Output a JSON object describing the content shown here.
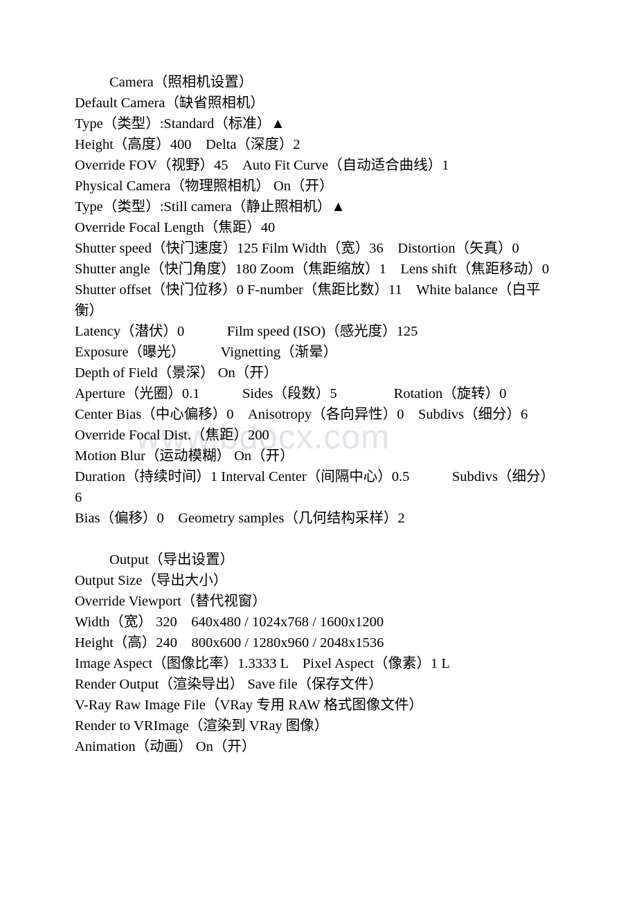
{
  "document": {
    "watermark": "www.bdocx.com",
    "sections": [
      {
        "id": "camera",
        "heading": "Camera（照相机设置）",
        "lines": [
          "Default Camera（缺省照相机）",
          "Type（类型）:Standard（标准）▲",
          "Height（高度）400　Delta（深度）2",
          "Override FOV（视野）45　Auto Fit Curve（自动适合曲线）1",
          "Physical Camera（物理照相机） On（开）",
          "Type（类型）:Still camera（静止照相机）▲",
          "Override Focal Length（焦距）40",
          "Shutter speed（快门速度）125 Film Width（宽）36　Distortion（矢真）0",
          "Shutter angle（快门角度）180 Zoom（焦距缩放）1　Lens shift（焦距移动）0",
          "Shutter offset（快门位移）0 F-number（焦距比数）11　White balance（白平衡）",
          "Latency（潜伏）0　　　Film speed (ISO)（感光度）125",
          "Exposure（曝光）　　　Vignetting（渐晕）",
          "Depth of Field（景深） On（开）",
          "Aperture（光圈）0.1　　　Sides（段数）5　　　　Rotation（旋转）0",
          "Center Bias（中心偏移）0　Anisotropy（各向异性）0　Subdivs（细分）6",
          "Override Focal Dist.（焦距）200",
          "Motion Blur（运动模糊） On（开）",
          "Duration（持续时间）1 Interval Center（间隔中心）0.5　　　Subdivs（细分）6",
          "Bias（偏移）0　Geometry samples（几何结构采样）2"
        ]
      },
      {
        "id": "output",
        "heading": "Output（导出设置）",
        "lines": [
          "Output Size（导出大小）",
          "Override Viewport（替代视窗）",
          "Width（宽） 320　640x480 / 1024x768 / 1600x1200",
          "Height（高）240　800x600 / 1280x960 / 2048x1536",
          "Image Aspect（图像比率）1.3333 L　Pixel Aspect（像素）1 L",
          "Render Output（渲染导出） Save file（保存文件）",
          "V-Ray Raw Image File（VRay 专用 RAW 格式图像文件）",
          "Render to VRImage（渲染到 VRay 图像）",
          "Animation（动画） On（开）"
        ]
      }
    ]
  }
}
